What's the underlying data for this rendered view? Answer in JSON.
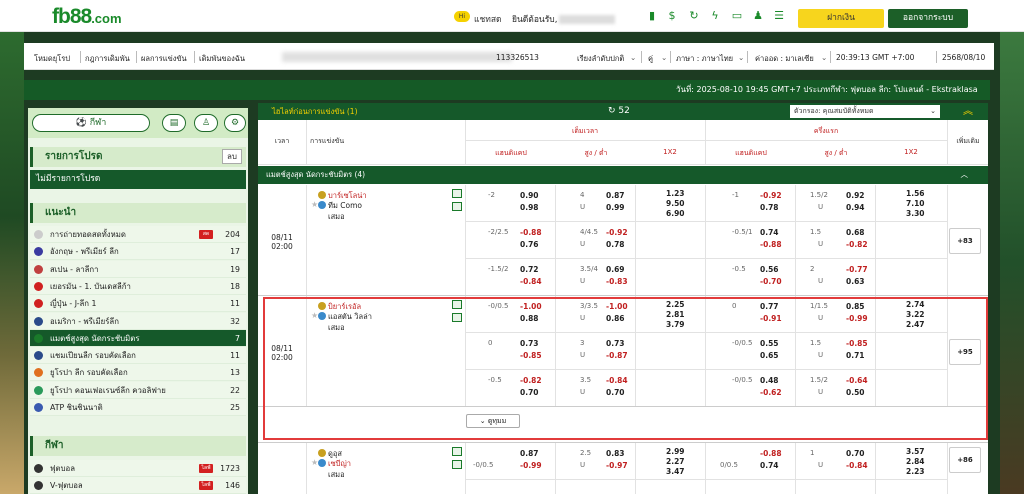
{
  "brand": {
    "logo": "fb88",
    "logo_suffix": ".com",
    "accent": "#1c5f28",
    "yellow": "#f7d51d"
  },
  "topbar": {
    "chat_badge": "Hi",
    "chat": "แชทสด",
    "welcome": "ยินดีต้อนรับ,",
    "deposit": "ฝากเงิน",
    "logout": "ออกจากระบบ",
    "icons": [
      "phone-icon",
      "wallet-icon",
      "refresh-icon",
      "flash-icon",
      "coupon-icon",
      "profile-icon",
      "list-icon"
    ]
  },
  "nav": {
    "links": [
      "โหมดยุโรป",
      "กฎการเดิมพัน",
      "ผลการแข่งขัน",
      "เดิมพันของฉัน"
    ],
    "account_id": "113326513",
    "settings": [
      "เรียงลำดับปกติ",
      "คู่",
      "ภาษา : ภาษาไทย",
      "ค่าออด : มาเลเซีย",
      "20:39:13 GMT +7:00",
      "2568/08/10"
    ]
  },
  "infobar": {
    "text": "วันที่: 2025-08-10 19:45 GMT+7 ประเภทกีฬา: ฟุตบอล ลีก: โปแลนด์ - Ekstraklasa"
  },
  "sidebar": {
    "tab_sport": "กีฬา",
    "fav_title": "รายการโปรด",
    "fav_del": "ลบ",
    "fav_empty": "ไม่มีรายการโปรด",
    "rec_title": "แนะนำ",
    "rec_items": [
      {
        "label": "การถ่ายทอดสดทั้งหมด",
        "count": "204",
        "hot": "สด"
      },
      {
        "label": "อังกฤษ - พรีเมียร์ ลีก",
        "count": "17"
      },
      {
        "label": "สเปน - ลาลีกา",
        "count": "19"
      },
      {
        "label": "เยอรมัน - 1. บันเดสลีก้า",
        "count": "18"
      },
      {
        "label": "ญี่ปุ่น - J-ลีก 1",
        "count": "11"
      },
      {
        "label": "อเมริกา - พรีเมียร์ลีก",
        "count": "32"
      },
      {
        "label": "แมตช์สูงสุด นัดกระชับมิตร",
        "count": "7",
        "active": true
      },
      {
        "label": "แชมเปียนลีก รอบคัดเลือก",
        "count": "11"
      },
      {
        "label": "ยูโรปา ลีก รอบคัดเลือก",
        "count": "13"
      },
      {
        "label": "ยูโรปา คอนเฟอเรนซ์ลีก ควอลิฟาย",
        "count": "22"
      },
      {
        "label": "ATP ชินชินนาติ",
        "count": "25"
      }
    ],
    "sport_title": "กีฬา",
    "sport_items": [
      {
        "label": "ฟุตบอล",
        "count": "1723",
        "hot": "ไลฟ์"
      },
      {
        "label": "V-ฟุตบอล",
        "count": "146",
        "hot": "ไลฟ์"
      }
    ]
  },
  "main": {
    "live_label": "ไฮไลท์ก่อนการแข่งขัน (1)",
    "refresh_count": "52",
    "filter": "ตัวกรอง: คุณสมบัติทั้งหมด",
    "headers": {
      "time": "เวลา",
      "match": "การแข่งขัน",
      "full": "เต็มเวลา",
      "half": "ครึ่งแรก",
      "hdp": "แฮนดิแคป",
      "ou": "สูง / ต่ำ",
      "x12": "1X2",
      "more": "เพิ่มเติม"
    },
    "league": "แมตช์สูงสุด นัดกระชับมิตร (4)",
    "expand": "ดูทุมม"
  },
  "matches": [
    {
      "date": "08/11",
      "time": "02:00",
      "home": "บาร์เซโลน่า",
      "away": "ทีม Como",
      "draw": "เสมอ",
      "home_red": true,
      "away_red": false,
      "more": "+83",
      "lines": [
        {
          "fh": "-2",
          "fh1": "0.90",
          "fh2": "0.98",
          "fo": "4",
          "fo2": "U",
          "fo1v": "0.87",
          "fo2v": "0.99",
          "x1": "1.23",
          "x2": "9.50",
          "x3": "6.90",
          "hh": "-1",
          "hh1": "-0.92",
          "hh2": "0.78",
          "ho": "1.5/2",
          "ho2": "U",
          "ho1v": "0.92",
          "ho2v": "0.94",
          "y1": "1.56",
          "y2": "7.10",
          "y3": "3.30"
        },
        {
          "fh": "-2/2.5",
          "fh1": "-0.88",
          "fh2": "0.76",
          "fo": "4/4.5",
          "fo2": "U",
          "fo1v": "-0.92",
          "fo2v": "0.78",
          "hh": "-0.5/1",
          "hh1": "0.74",
          "hh2": "-0.88",
          "ho": "1.5",
          "ho2": "U",
          "ho1v": "0.68",
          "ho2v": "-0.82"
        },
        {
          "fh": "-1.5/2",
          "fh1": "0.72",
          "fh2": "-0.84",
          "fo": "3.5/4",
          "fo2": "U",
          "fo1v": "0.69",
          "fo2v": "-0.83",
          "hh": "-0.5",
          "hh1": "0.56",
          "hh2": "-0.70",
          "ho": "2",
          "ho2": "U",
          "ho1v": "-0.77",
          "ho2v": "0.63"
        }
      ]
    },
    {
      "date": "08/11",
      "time": "02:00",
      "home": "บิยาร์เรอัล",
      "away": "แอสตัน วิลล่า",
      "draw": "เสมอ",
      "home_red": true,
      "away_red": false,
      "more": "+95",
      "lines": [
        {
          "fh": "-0/0.5",
          "fh1": "-1.00",
          "fh2": "0.88",
          "fo": "3/3.5",
          "fo2": "U",
          "fo1v": "-1.00",
          "fo2v": "0.86",
          "x1": "2.25",
          "x2": "2.81",
          "x3": "3.79",
          "hh": "0",
          "hh1": "0.77",
          "hh2": "-0.91",
          "ho": "1/1.5",
          "ho2": "U",
          "ho1v": "0.85",
          "ho2v": "-0.99",
          "y1": "2.74",
          "y2": "3.22",
          "y3": "2.47"
        },
        {
          "fh": "0",
          "fh1": "0.73",
          "fh2": "-0.85",
          "fo": "3",
          "fo2": "U",
          "fo1v": "0.73",
          "fo2v": "-0.87",
          "hh": "-0/0.5",
          "hh1": "0.55",
          "hh2": "0.65",
          "ho": "1.5",
          "ho2": "U",
          "ho1v": "-0.85",
          "ho2v": "0.71"
        },
        {
          "fh": "-0.5",
          "fh1": "-0.82",
          "fh2": "0.70",
          "fo": "3.5",
          "fo2": "U",
          "fo1v": "-0.84",
          "fo2v": "0.70",
          "hh": "-0/0.5",
          "hh1": "0.48",
          "hh2": "-0.62",
          "ho": "1.5/2",
          "ho2": "U",
          "ho1v": "-0.64",
          "ho2v": "0.50"
        }
      ]
    },
    {
      "home": "ดูอุส",
      "away": "เซบีญ่า",
      "draw": "เสมอ",
      "home_red": false,
      "away_red": true,
      "more": "+86",
      "lines": [
        {
          "fh": "",
          "fh1": "0.87",
          "fh2": "-0.99",
          "fo": "2.5",
          "fo2": "U",
          "fo1v": "0.83",
          "fo2v": "-0.97",
          "x1": "2.99",
          "x2": "2.27",
          "x3": "3.47",
          "hh": "",
          "hh1": "-0.88",
          "hh2": "0.74",
          "ho": "1",
          "ho2": "U",
          "ho1v": "0.70",
          "ho2v": "-0.84",
          "y1": "3.57",
          "y2": "2.84",
          "y3": "2.23",
          "fh_b": "-0/0.5",
          "hh_b": "0/0.5"
        }
      ]
    }
  ]
}
